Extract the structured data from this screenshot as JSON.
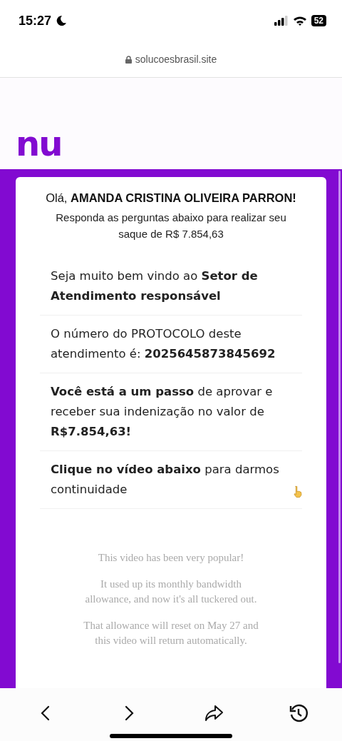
{
  "status_bar": {
    "time": "15:27",
    "battery": "52"
  },
  "address_bar": {
    "url": "solucoesbrasil.site"
  },
  "logo": {
    "text": "nu"
  },
  "card": {
    "greeting": "Olá, **AMANDA CRISTINA OLIVEIRA PARRON!**",
    "subtitle": "Responda as perguntas abaixo para realizar seu saque de R$ 7.854,63",
    "messages": [
      {
        "text": "Seja muito bem vindo ao **Setor de Atendimento responsável**",
        "kind": "plain"
      },
      {
        "text": "O número do PROTOCOLO deste atendimento é: **2025645873845692**",
        "kind": "plain"
      },
      {
        "text": "**Você está a um passo** de aprovar e receber sua indenização no valor de **R$7.854,63!**",
        "kind": "plain"
      },
      {
        "text": "**Clique no vídeo abaixo** para darmos continuidade",
        "kind": "pointer"
      }
    ],
    "video_notice": [
      "This video has been very popular!",
      "It used up its monthly bandwidth allowance, and now it's all tuckered out.",
      "That allowance will reset on May 27 and this video will return automatically."
    ]
  }
}
